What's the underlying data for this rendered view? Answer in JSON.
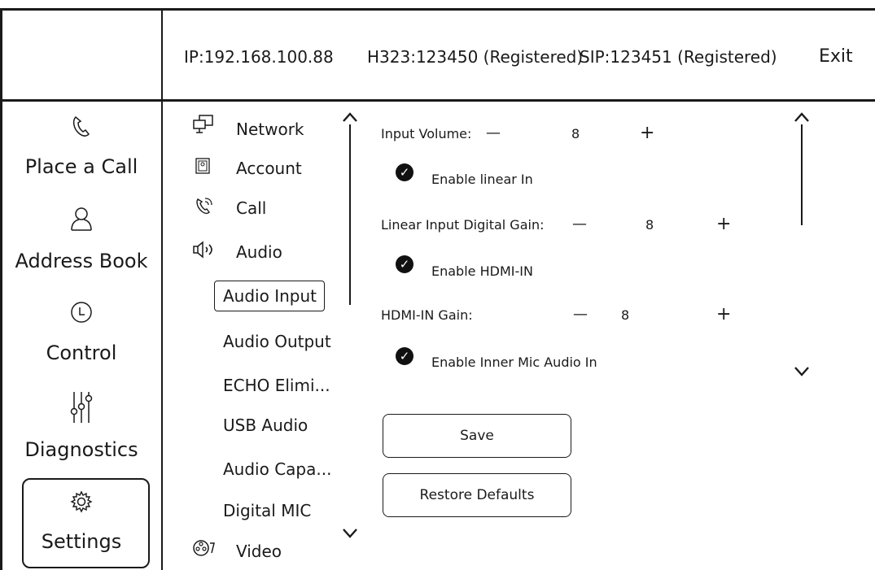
{
  "header": {
    "ip": "IP:192.168.100.88",
    "h323": "H323:123450 (Registered)",
    "sip": "SIP:123451 (Registered)",
    "exit": "Exit"
  },
  "nav": {
    "place_call": "Place a Call",
    "address_book": "Address Book",
    "control": "Control",
    "diagnostics": "Diagnostics",
    "settings": "Settings"
  },
  "menu": {
    "network": "Network",
    "account": "Account",
    "call": "Call",
    "audio": "Audio",
    "audio_input": "Audio Input",
    "audio_output": "Audio Output",
    "echo": "ECHO Elimi...",
    "usb_audio": "USB Audio",
    "audio_capa": "Audio Capa...",
    "digital_mic": "Digital MIC",
    "video": "Video"
  },
  "settings": {
    "input_volume_label": "Input Volume:",
    "input_volume_value": "8",
    "enable_linear_in": "Enable linear In",
    "linear_gain_label": "Linear Input Digital Gain:",
    "linear_gain_value": "8",
    "enable_hdmi_in": "Enable HDMI-IN",
    "hdmi_gain_label": "HDMI-IN Gain:",
    "hdmi_gain_value": "8",
    "enable_inner_mic": "Enable Inner Mic Audio In",
    "minus": "—",
    "plus": "+",
    "check": "✓",
    "save": "Save",
    "restore": "Restore Defaults"
  }
}
